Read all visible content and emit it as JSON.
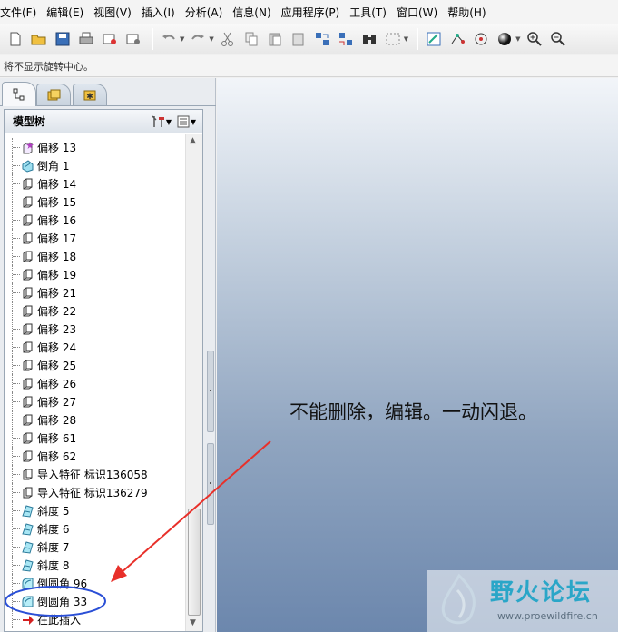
{
  "menu": [
    "文件(F)",
    "编辑(E)",
    "视图(V)",
    "插入(I)",
    "分析(A)",
    "信息(N)",
    "应用程序(P)",
    "工具(T)",
    "窗口(W)",
    "帮助(H)"
  ],
  "message": "将不显示旋转中心。",
  "tree": {
    "title": "模型树",
    "items": [
      {
        "label": "偏移 13",
        "icon": "offset-star-icon"
      },
      {
        "label": "倒角 1",
        "icon": "chamfer-icon"
      },
      {
        "label": "偏移 14",
        "icon": "offset-icon"
      },
      {
        "label": "偏移 15",
        "icon": "offset-icon"
      },
      {
        "label": "偏移 16",
        "icon": "offset-icon"
      },
      {
        "label": "偏移 17",
        "icon": "offset-icon"
      },
      {
        "label": "偏移 18",
        "icon": "offset-icon"
      },
      {
        "label": "偏移 19",
        "icon": "offset-icon"
      },
      {
        "label": "偏移 21",
        "icon": "offset-icon"
      },
      {
        "label": "偏移 22",
        "icon": "offset-icon"
      },
      {
        "label": "偏移 23",
        "icon": "offset-icon"
      },
      {
        "label": "偏移 24",
        "icon": "offset-icon"
      },
      {
        "label": "偏移 25",
        "icon": "offset-icon"
      },
      {
        "label": "偏移 26",
        "icon": "offset-icon"
      },
      {
        "label": "偏移 27",
        "icon": "offset-icon"
      },
      {
        "label": "偏移 28",
        "icon": "offset-icon"
      },
      {
        "label": "偏移 61",
        "icon": "offset-icon"
      },
      {
        "label": "偏移 62",
        "icon": "offset-icon"
      },
      {
        "label": "导入特征 标识136058",
        "icon": "import-feature-icon"
      },
      {
        "label": "导入特征 标识136279",
        "icon": "import-feature-icon"
      },
      {
        "label": "斜度 5",
        "icon": "draft-icon"
      },
      {
        "label": "斜度 6",
        "icon": "draft-icon"
      },
      {
        "label": "斜度 7",
        "icon": "draft-icon"
      },
      {
        "label": "斜度 8",
        "icon": "draft-icon"
      },
      {
        "label": "倒圆角 96",
        "icon": "round-icon"
      },
      {
        "label": "倒圆角 33",
        "icon": "round-icon"
      },
      {
        "label": "在此插入",
        "icon": "insert-here-icon"
      }
    ]
  },
  "annotation": "不能删除，编辑。一动闪退。",
  "watermark": {
    "title": "野火论坛",
    "url": "www.proewildfire.cn"
  },
  "colors": {
    "arrow": "#e8302a",
    "circle": "#2a4fd6",
    "accent": "#2aa6c8"
  }
}
